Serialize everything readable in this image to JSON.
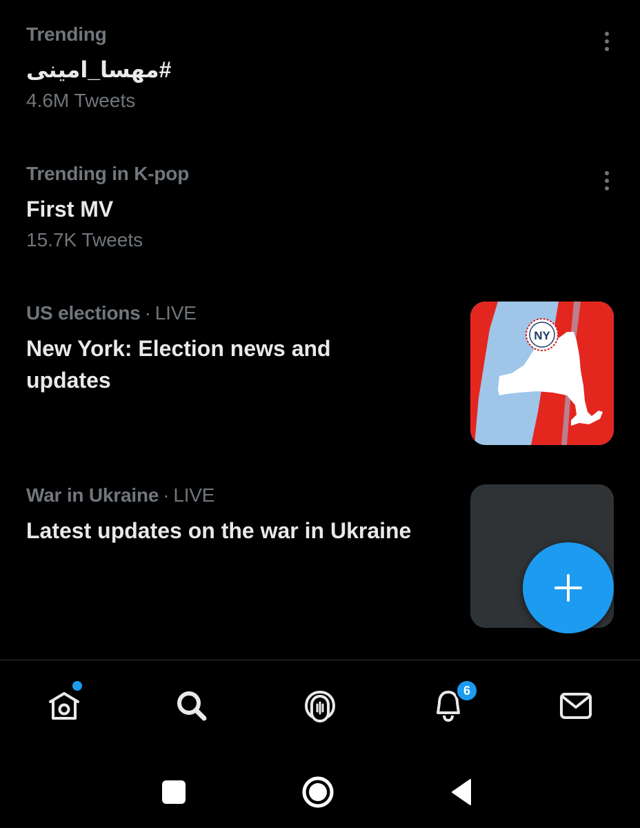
{
  "trends": [
    {
      "context": "Trending",
      "title": "#مهسا_امینی",
      "count": "4.6M Tweets"
    },
    {
      "context": "Trending in K-pop",
      "title": "First MV",
      "count": "15.7K Tweets"
    }
  ],
  "events": [
    {
      "category": "US elections",
      "live": "LIVE",
      "title_line1": "New York: Election news and",
      "title_line2": "updates",
      "badge": "NY"
    },
    {
      "category": "War in Ukraine",
      "live": "LIVE",
      "title": "Latest updates on the war in Ukraine"
    }
  ],
  "separator": "·",
  "fab": {
    "icon": "plus-icon"
  },
  "nav": {
    "items": [
      "home-icon",
      "search-icon",
      "spaces-icon",
      "notifications-icon",
      "messages-icon"
    ],
    "notifications_badge": "6"
  },
  "system_nav": [
    "recent-apps-icon",
    "home-circle-icon",
    "back-icon"
  ],
  "colors": {
    "background": "#000000",
    "accent": "#1d9bf0",
    "muted": "#71767b",
    "text": "#e7e9ea"
  }
}
